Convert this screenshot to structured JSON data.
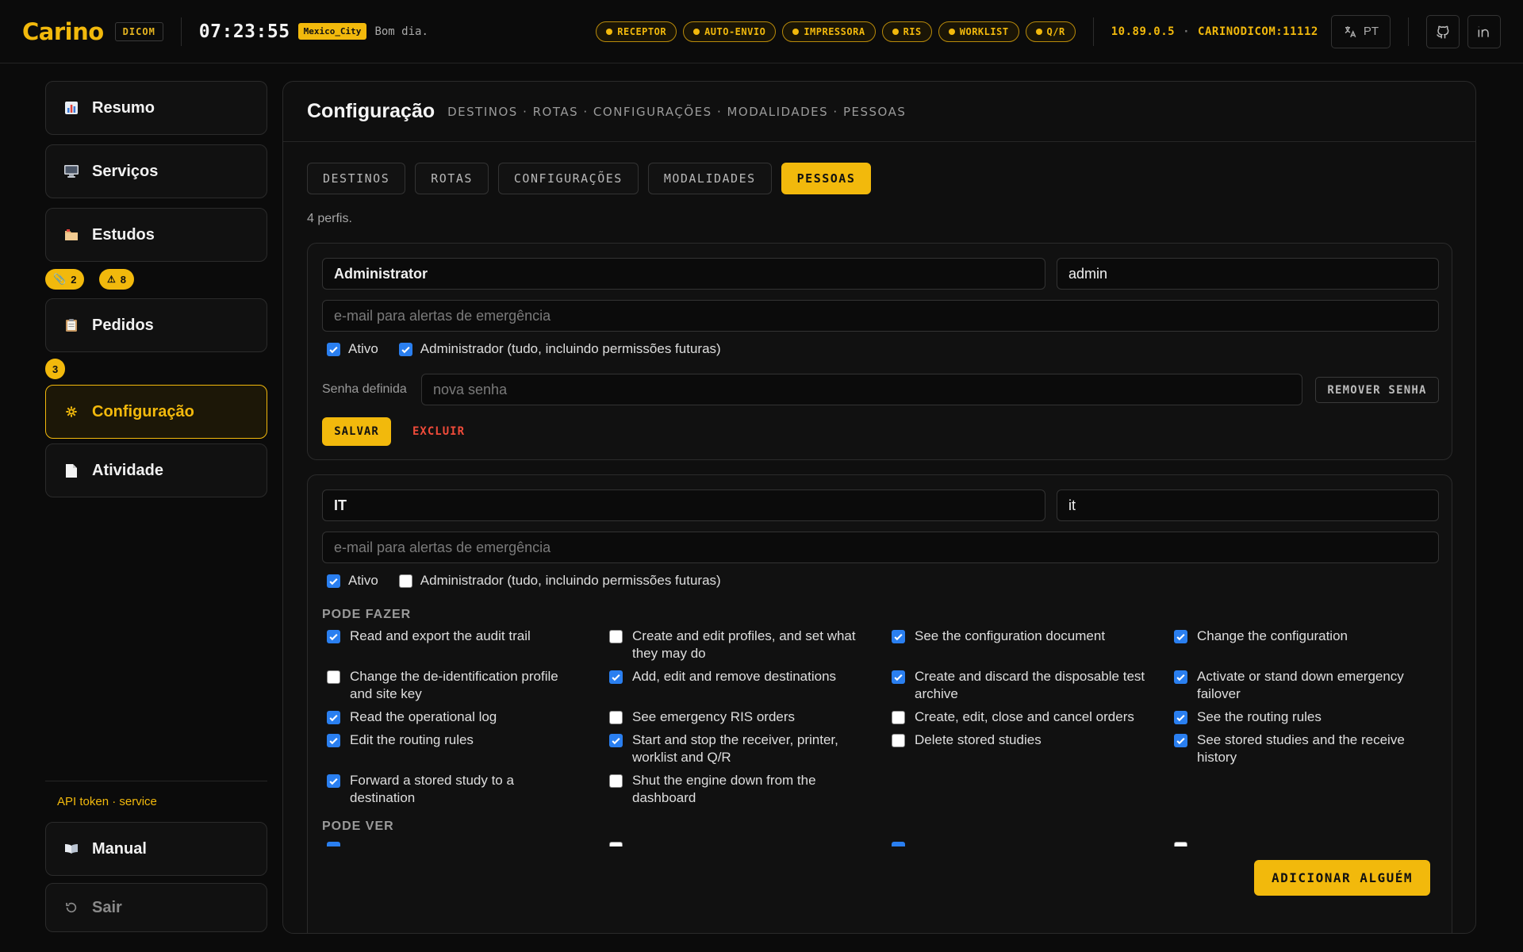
{
  "header": {
    "brand": "Carino",
    "dicom_badge": "DICOM",
    "clock": "07:23:55",
    "timezone": "Mexico_City",
    "greeting": "Bom dia.",
    "status_pills": [
      "RECEPTOR",
      "AUTO-ENVIO",
      "IMPRESSORA",
      "RIS",
      "WORKLIST",
      "Q/R"
    ],
    "ip": "10.89.0.5",
    "ae_title": "CARINODICOM:11112",
    "language": "PT"
  },
  "sidebar": {
    "items": [
      {
        "label": "Resumo",
        "icon": "bar-chart-icon"
      },
      {
        "label": "Serviços",
        "icon": "monitor-icon"
      },
      {
        "label": "Estudos",
        "icon": "folder-icon"
      },
      {
        "label": "Pedidos",
        "icon": "clipboard-icon"
      },
      {
        "label": "Configuração",
        "icon": "gear-icon"
      },
      {
        "label": "Atividade",
        "icon": "document-icon"
      }
    ],
    "estudos_badges": [
      {
        "icon": "paperclip-icon",
        "count": "2"
      },
      {
        "icon": "warning-icon",
        "count": "8"
      }
    ],
    "pedidos_badge": "3",
    "api_token": "API token · service",
    "manual": "Manual",
    "logout": "Sair"
  },
  "main": {
    "title": "Configuração",
    "crumbs": "DESTINOS · ROTAS · CONFIGURAÇÕES · MODALIDADES · PESSOAS",
    "tabs": [
      "DESTINOS",
      "ROTAS",
      "CONFIGURAÇÕES",
      "MODALIDADES",
      "PESSOAS"
    ],
    "active_tab": "PESSOAS",
    "profile_count": "4 perfis.",
    "profiles": [
      {
        "name": "Administrator",
        "username": "admin",
        "email_placeholder": "e-mail para alertas de emergência",
        "active_label": "Ativo",
        "active": true,
        "admin_label": "Administrador (tudo, incluindo permissões futuras)",
        "admin": true,
        "password_label": "Senha definida",
        "password_placeholder": "nova senha",
        "remove_password": "REMOVER SENHA",
        "save": "SALVAR",
        "delete": "EXCLUIR"
      },
      {
        "name": "IT",
        "username": "it",
        "email_placeholder": "e-mail para alertas de emergência",
        "active_label": "Ativo",
        "active": true,
        "admin_label": "Administrador (tudo, incluindo permissões futuras)",
        "admin": false,
        "can_do_label": "PODE FAZER",
        "permissions": [
          {
            "label": "Read and export the audit trail",
            "checked": true
          },
          {
            "label": "Create and edit profiles, and set what they may do",
            "checked": false
          },
          {
            "label": "See the configuration document",
            "checked": true
          },
          {
            "label": "Change the configuration",
            "checked": true
          },
          {
            "label": "Change the de-identification profile and site key",
            "checked": false
          },
          {
            "label": "Add, edit and remove destinations",
            "checked": true
          },
          {
            "label": "Create and discard the disposable test archive",
            "checked": true
          },
          {
            "label": "Activate or stand down emergency failover",
            "checked": true
          },
          {
            "label": "Read the operational log",
            "checked": true
          },
          {
            "label": "See emergency RIS orders",
            "checked": false
          },
          {
            "label": "Create, edit, close and cancel orders",
            "checked": false
          },
          {
            "label": "See the routing rules",
            "checked": true
          },
          {
            "label": "Edit the routing rules",
            "checked": true
          },
          {
            "label": "Start and stop the receiver, printer, worklist and Q/R",
            "checked": true
          },
          {
            "label": "Delete stored studies",
            "checked": false
          },
          {
            "label": "See stored studies and the receive history",
            "checked": true
          },
          {
            "label": "Forward a stored study to a destination",
            "checked": true
          },
          {
            "label": "Shut the engine down from the dashboard",
            "checked": false
          }
        ],
        "can_see_label": "PODE VER"
      }
    ],
    "add_button": "ADICIONAR ALGUÉM"
  },
  "colors": {
    "accent": "#f2b90c",
    "danger": "#f04b3a",
    "checkbox": "#2a7ff0",
    "background": "#0b0b0b"
  }
}
